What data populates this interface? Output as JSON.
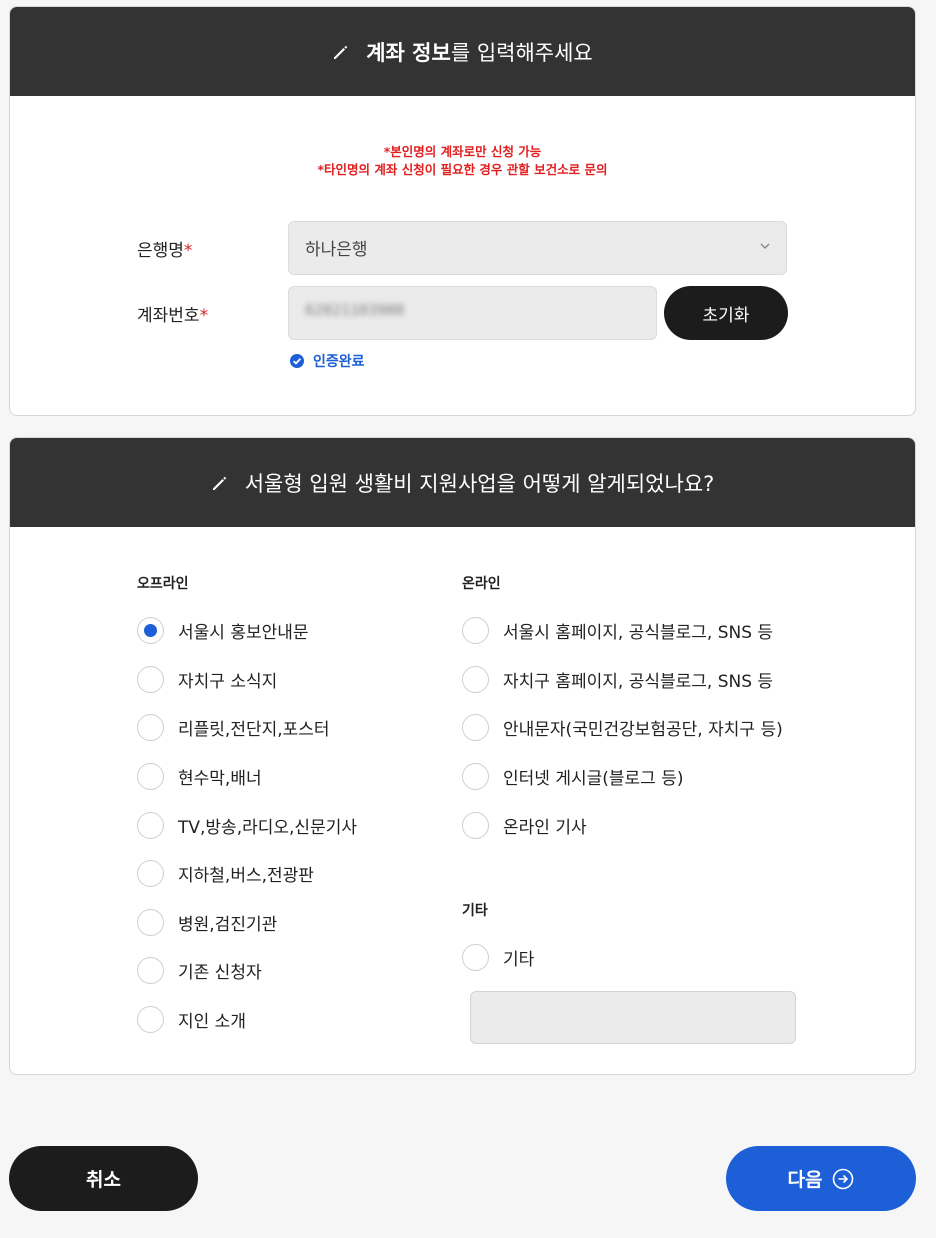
{
  "account": {
    "title_bold": "계좌 정보",
    "title_rest": "를 입력해주세요",
    "notice1": "*본인명의 계좌로만 신청 가능",
    "notice2": "*타인명의 계좌 신청이 필요한 경우 관할 보건소로 문의",
    "bank_label": "은행명",
    "bank_value": "하나은행",
    "account_label": "계좌번호",
    "required_mark": "*",
    "account_value": "62021103900",
    "reset_label": "초기화",
    "verified_label": "인증완료"
  },
  "survey": {
    "title": "서울형 입원 생활비 지원사업을 어떻게 알게되었나요?",
    "offline_title": "오프라인",
    "offline": [
      "서울시 홍보안내문",
      "자치구 소식지",
      "리플릿,전단지,포스터",
      "현수막,배너",
      "TV,방송,라디오,신문기사",
      "지하철,버스,전광판",
      "병원,검진기관",
      "기존 신청자",
      "지인 소개"
    ],
    "online_title": "온라인",
    "online": [
      "서울시 홈페이지, 공식블로그, SNS 등",
      "자치구 홈페이지, 공식블로그, SNS 등",
      "안내문자(국민건강보험공단, 자치구 등)",
      "인터넷 게시글(블로그 등)",
      "온라인 기사"
    ],
    "etc_title": "기타",
    "etc_option": "기타"
  },
  "buttons": {
    "cancel": "취소",
    "next": "다음"
  },
  "colors": {
    "header_bg": "#333333",
    "accent": "#1d5fd6",
    "notice": "#e02020"
  },
  "icons": [
    "pencil-icon",
    "chevron-down-icon",
    "check-circle-icon",
    "arrow-circle-right-icon"
  ]
}
